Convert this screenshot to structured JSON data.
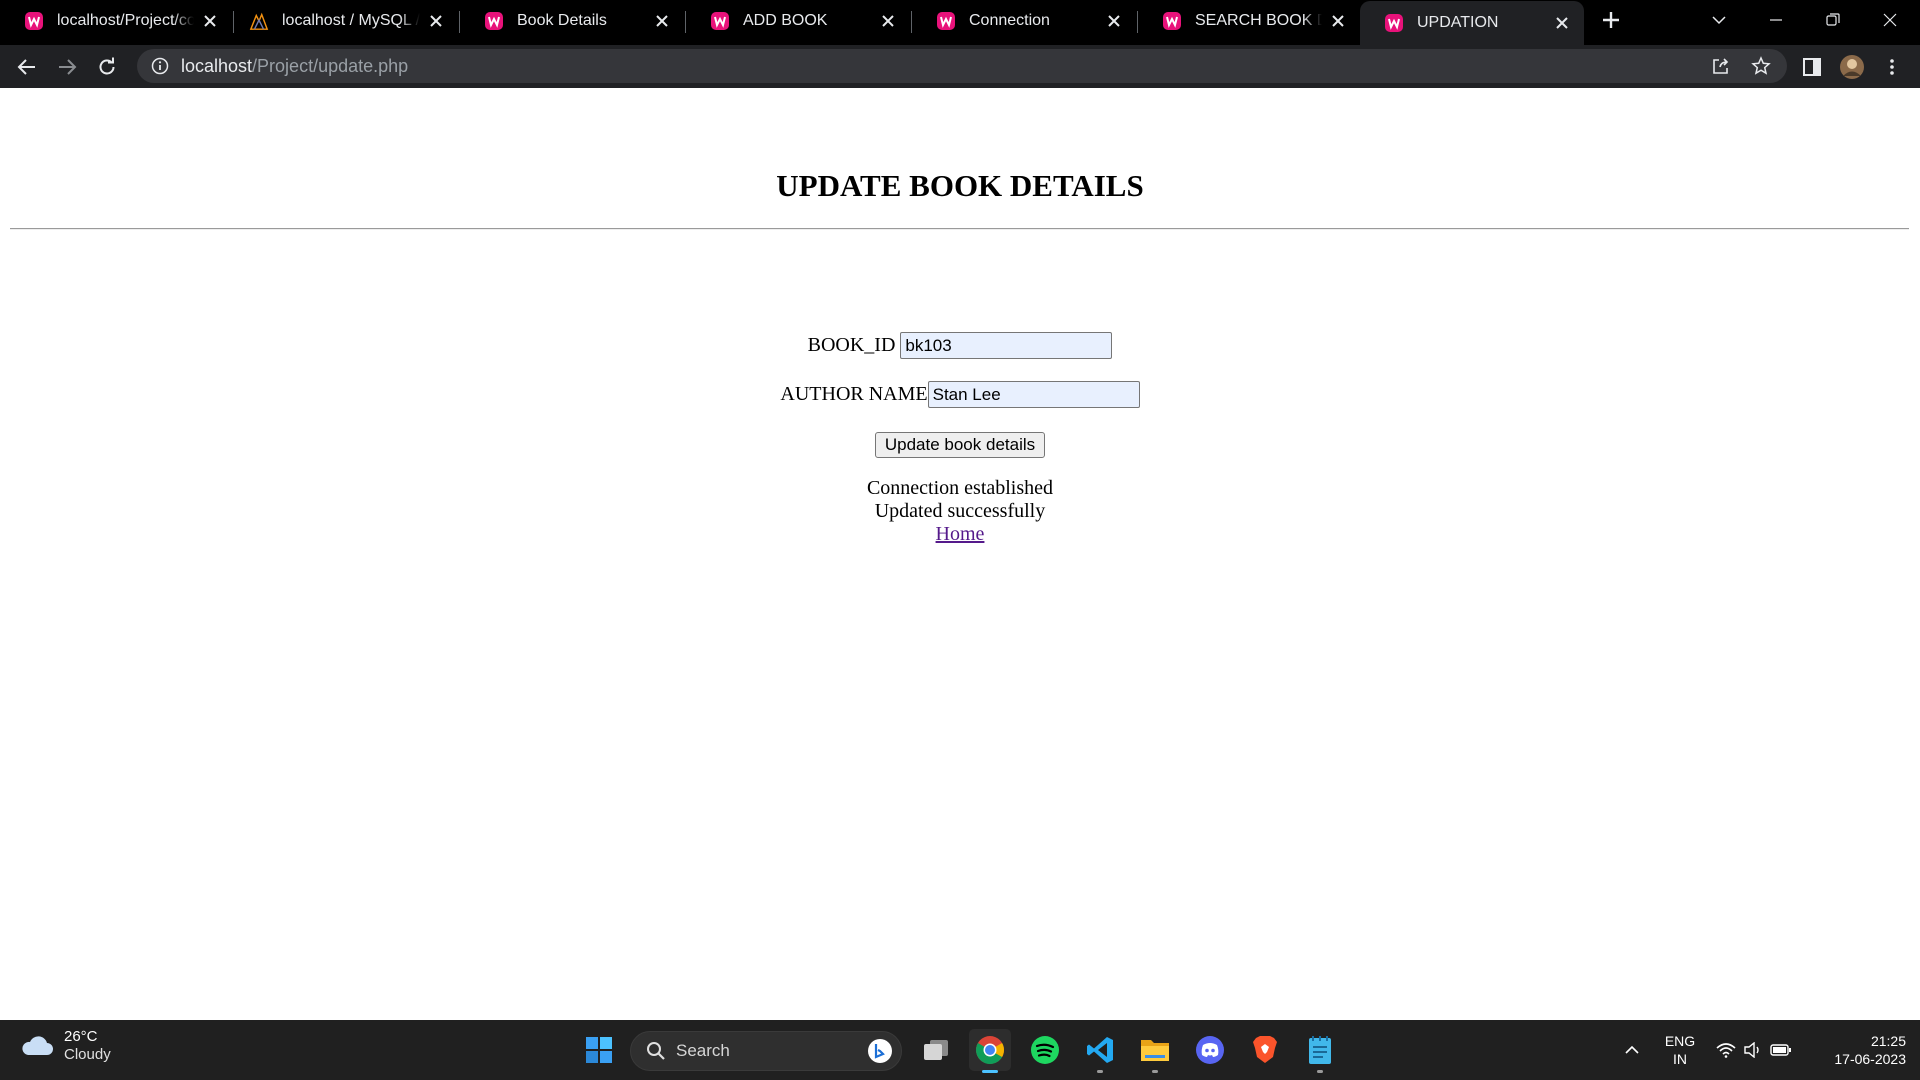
{
  "browser": {
    "tabs": [
      {
        "title": "localhost/Project/conn",
        "icon": "wamp-icon",
        "active": false
      },
      {
        "title": "localhost / MySQL / test",
        "icon": "phpmyadmin-icon",
        "active": false
      },
      {
        "title": "Book Details",
        "icon": "wamp-icon",
        "active": false
      },
      {
        "title": "ADD BOOK",
        "icon": "wamp-icon",
        "active": false
      },
      {
        "title": "Connection",
        "icon": "wamp-icon",
        "active": false
      },
      {
        "title": "SEARCH BOOK DETAILS",
        "icon": "wamp-icon",
        "active": false
      },
      {
        "title": "UPDATION",
        "icon": "wamp-icon",
        "active": true
      }
    ],
    "url": {
      "host": "localhost",
      "path": "/Project/update.php"
    },
    "colors": {
      "tab_strip": "#000000",
      "toolbar": "#202124",
      "omnibox": "#35363a",
      "favicon": "#e8127a"
    }
  },
  "page": {
    "title": "UPDATE BOOK DETAILS",
    "form": {
      "book_id_label": "BOOK_ID",
      "book_id_value": "bk103",
      "author_label": "AUTHOR NAME",
      "author_value": "Stan Lee",
      "submit_label": "Update book details"
    },
    "messages": {
      "connection": "Connection established",
      "result": "Updated successfully",
      "home_link": "Home"
    }
  },
  "taskbar": {
    "weather": {
      "temp": "26°C",
      "condition": "Cloudy"
    },
    "search_label": "Search",
    "apps": [
      "windows-start-icon",
      "task-view-icon",
      "chrome-icon",
      "spotify-icon",
      "vscode-icon",
      "file-explorer-icon",
      "discord-icon",
      "brave-icon",
      "notepad-icon"
    ],
    "language": {
      "line1": "ENG",
      "line2": "IN"
    },
    "clock": {
      "time": "21:25",
      "date": "17-06-2023"
    }
  }
}
